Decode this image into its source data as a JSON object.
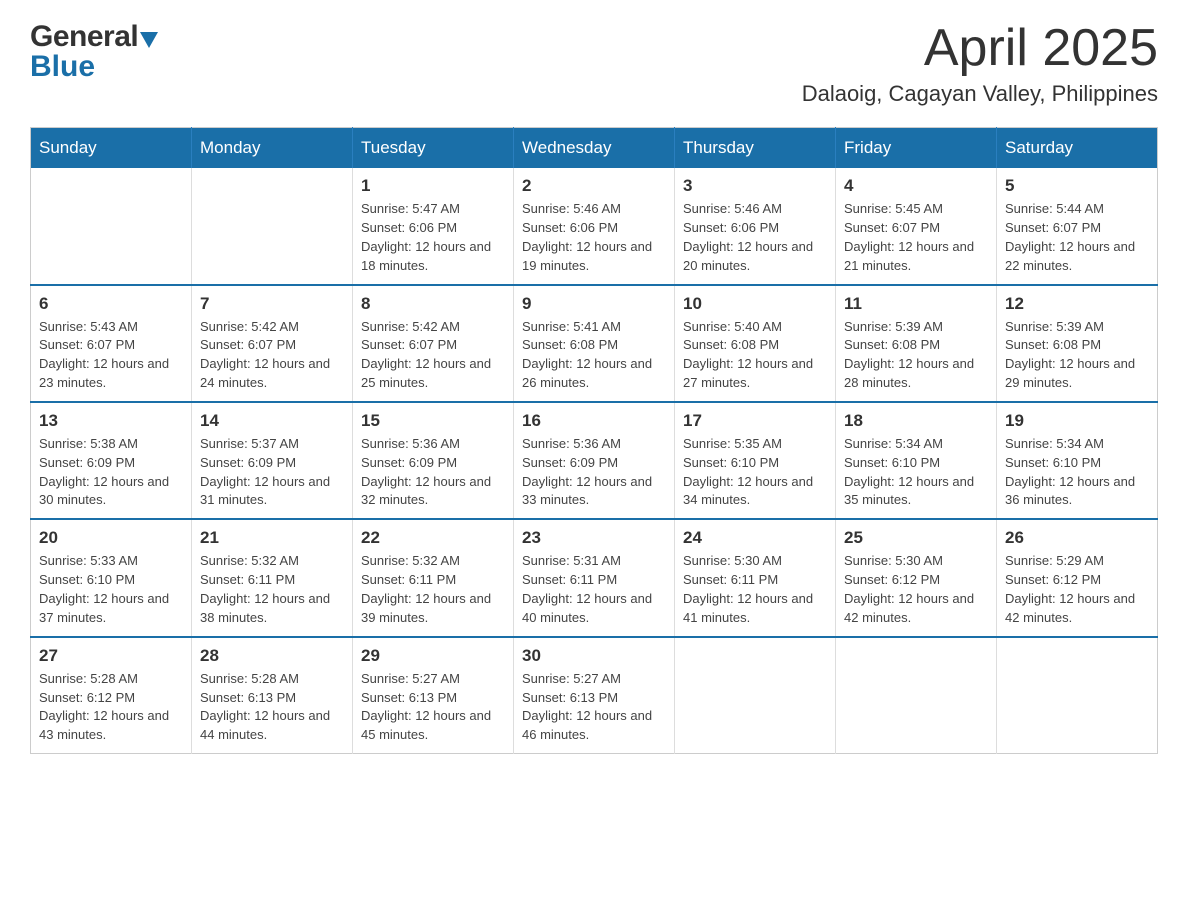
{
  "header": {
    "logo_general": "General",
    "logo_blue": "Blue",
    "month_title": "April 2025",
    "location": "Dalaoig, Cagayan Valley, Philippines"
  },
  "weekdays": [
    "Sunday",
    "Monday",
    "Tuesday",
    "Wednesday",
    "Thursday",
    "Friday",
    "Saturday"
  ],
  "weeks": [
    [
      {
        "day": "",
        "info": ""
      },
      {
        "day": "",
        "info": ""
      },
      {
        "day": "1",
        "info": "Sunrise: 5:47 AM\nSunset: 6:06 PM\nDaylight: 12 hours\nand 18 minutes."
      },
      {
        "day": "2",
        "info": "Sunrise: 5:46 AM\nSunset: 6:06 PM\nDaylight: 12 hours\nand 19 minutes."
      },
      {
        "day": "3",
        "info": "Sunrise: 5:46 AM\nSunset: 6:06 PM\nDaylight: 12 hours\nand 20 minutes."
      },
      {
        "day": "4",
        "info": "Sunrise: 5:45 AM\nSunset: 6:07 PM\nDaylight: 12 hours\nand 21 minutes."
      },
      {
        "day": "5",
        "info": "Sunrise: 5:44 AM\nSunset: 6:07 PM\nDaylight: 12 hours\nand 22 minutes."
      }
    ],
    [
      {
        "day": "6",
        "info": "Sunrise: 5:43 AM\nSunset: 6:07 PM\nDaylight: 12 hours\nand 23 minutes."
      },
      {
        "day": "7",
        "info": "Sunrise: 5:42 AM\nSunset: 6:07 PM\nDaylight: 12 hours\nand 24 minutes."
      },
      {
        "day": "8",
        "info": "Sunrise: 5:42 AM\nSunset: 6:07 PM\nDaylight: 12 hours\nand 25 minutes."
      },
      {
        "day": "9",
        "info": "Sunrise: 5:41 AM\nSunset: 6:08 PM\nDaylight: 12 hours\nand 26 minutes."
      },
      {
        "day": "10",
        "info": "Sunrise: 5:40 AM\nSunset: 6:08 PM\nDaylight: 12 hours\nand 27 minutes."
      },
      {
        "day": "11",
        "info": "Sunrise: 5:39 AM\nSunset: 6:08 PM\nDaylight: 12 hours\nand 28 minutes."
      },
      {
        "day": "12",
        "info": "Sunrise: 5:39 AM\nSunset: 6:08 PM\nDaylight: 12 hours\nand 29 minutes."
      }
    ],
    [
      {
        "day": "13",
        "info": "Sunrise: 5:38 AM\nSunset: 6:09 PM\nDaylight: 12 hours\nand 30 minutes."
      },
      {
        "day": "14",
        "info": "Sunrise: 5:37 AM\nSunset: 6:09 PM\nDaylight: 12 hours\nand 31 minutes."
      },
      {
        "day": "15",
        "info": "Sunrise: 5:36 AM\nSunset: 6:09 PM\nDaylight: 12 hours\nand 32 minutes."
      },
      {
        "day": "16",
        "info": "Sunrise: 5:36 AM\nSunset: 6:09 PM\nDaylight: 12 hours\nand 33 minutes."
      },
      {
        "day": "17",
        "info": "Sunrise: 5:35 AM\nSunset: 6:10 PM\nDaylight: 12 hours\nand 34 minutes."
      },
      {
        "day": "18",
        "info": "Sunrise: 5:34 AM\nSunset: 6:10 PM\nDaylight: 12 hours\nand 35 minutes."
      },
      {
        "day": "19",
        "info": "Sunrise: 5:34 AM\nSunset: 6:10 PM\nDaylight: 12 hours\nand 36 minutes."
      }
    ],
    [
      {
        "day": "20",
        "info": "Sunrise: 5:33 AM\nSunset: 6:10 PM\nDaylight: 12 hours\nand 37 minutes."
      },
      {
        "day": "21",
        "info": "Sunrise: 5:32 AM\nSunset: 6:11 PM\nDaylight: 12 hours\nand 38 minutes."
      },
      {
        "day": "22",
        "info": "Sunrise: 5:32 AM\nSunset: 6:11 PM\nDaylight: 12 hours\nand 39 minutes."
      },
      {
        "day": "23",
        "info": "Sunrise: 5:31 AM\nSunset: 6:11 PM\nDaylight: 12 hours\nand 40 minutes."
      },
      {
        "day": "24",
        "info": "Sunrise: 5:30 AM\nSunset: 6:11 PM\nDaylight: 12 hours\nand 41 minutes."
      },
      {
        "day": "25",
        "info": "Sunrise: 5:30 AM\nSunset: 6:12 PM\nDaylight: 12 hours\nand 42 minutes."
      },
      {
        "day": "26",
        "info": "Sunrise: 5:29 AM\nSunset: 6:12 PM\nDaylight: 12 hours\nand 42 minutes."
      }
    ],
    [
      {
        "day": "27",
        "info": "Sunrise: 5:28 AM\nSunset: 6:12 PM\nDaylight: 12 hours\nand 43 minutes."
      },
      {
        "day": "28",
        "info": "Sunrise: 5:28 AM\nSunset: 6:13 PM\nDaylight: 12 hours\nand 44 minutes."
      },
      {
        "day": "29",
        "info": "Sunrise: 5:27 AM\nSunset: 6:13 PM\nDaylight: 12 hours\nand 45 minutes."
      },
      {
        "day": "30",
        "info": "Sunrise: 5:27 AM\nSunset: 6:13 PM\nDaylight: 12 hours\nand 46 minutes."
      },
      {
        "day": "",
        "info": ""
      },
      {
        "day": "",
        "info": ""
      },
      {
        "day": "",
        "info": ""
      }
    ]
  ]
}
